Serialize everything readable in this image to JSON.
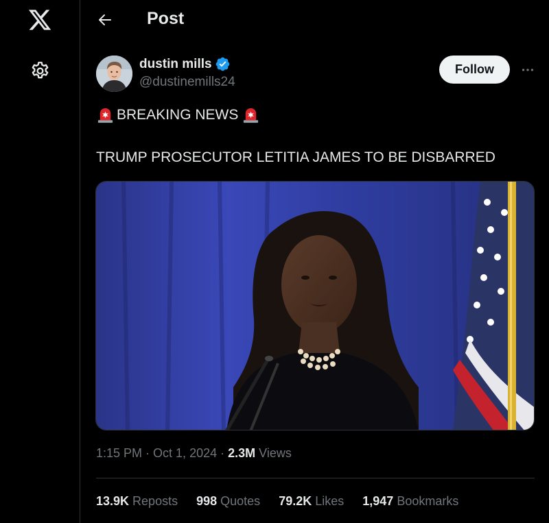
{
  "header": {
    "title": "Post",
    "back_icon": "arrow-left-icon"
  },
  "left_rail": {
    "logo": "x-logo-icon",
    "settings_icon": "gear-icon"
  },
  "author": {
    "display_name": "dustin mills",
    "handle": "@dustinemills24",
    "verified": true,
    "verified_color": "#1d9bf0"
  },
  "follow_button": {
    "label": "Follow"
  },
  "more_button": {
    "icon": "more-horizontal-icon"
  },
  "post": {
    "line1": "BREAKING NEWS",
    "line1_emoji": "police-car-light-emoji",
    "line2": "TRUMP PROSECUTOR LETITIA JAMES TO BE DISBARRED"
  },
  "meta": {
    "time": "1:15 PM",
    "sep1": "·",
    "date": "Oct 1, 2024",
    "sep2": "·",
    "views_count": "2.3M",
    "views_label": "Views"
  },
  "stats": [
    {
      "num": "13.9K",
      "label": "Reposts"
    },
    {
      "num": "998",
      "label": "Quotes"
    },
    {
      "num": "79.2K",
      "label": "Likes"
    },
    {
      "num": "1,947",
      "label": "Bookmarks"
    }
  ],
  "colors": {
    "background": "#000000",
    "text": "#e7e9ea",
    "muted": "#71767b",
    "border": "#2f3336",
    "follow_bg": "#eff3f4"
  }
}
